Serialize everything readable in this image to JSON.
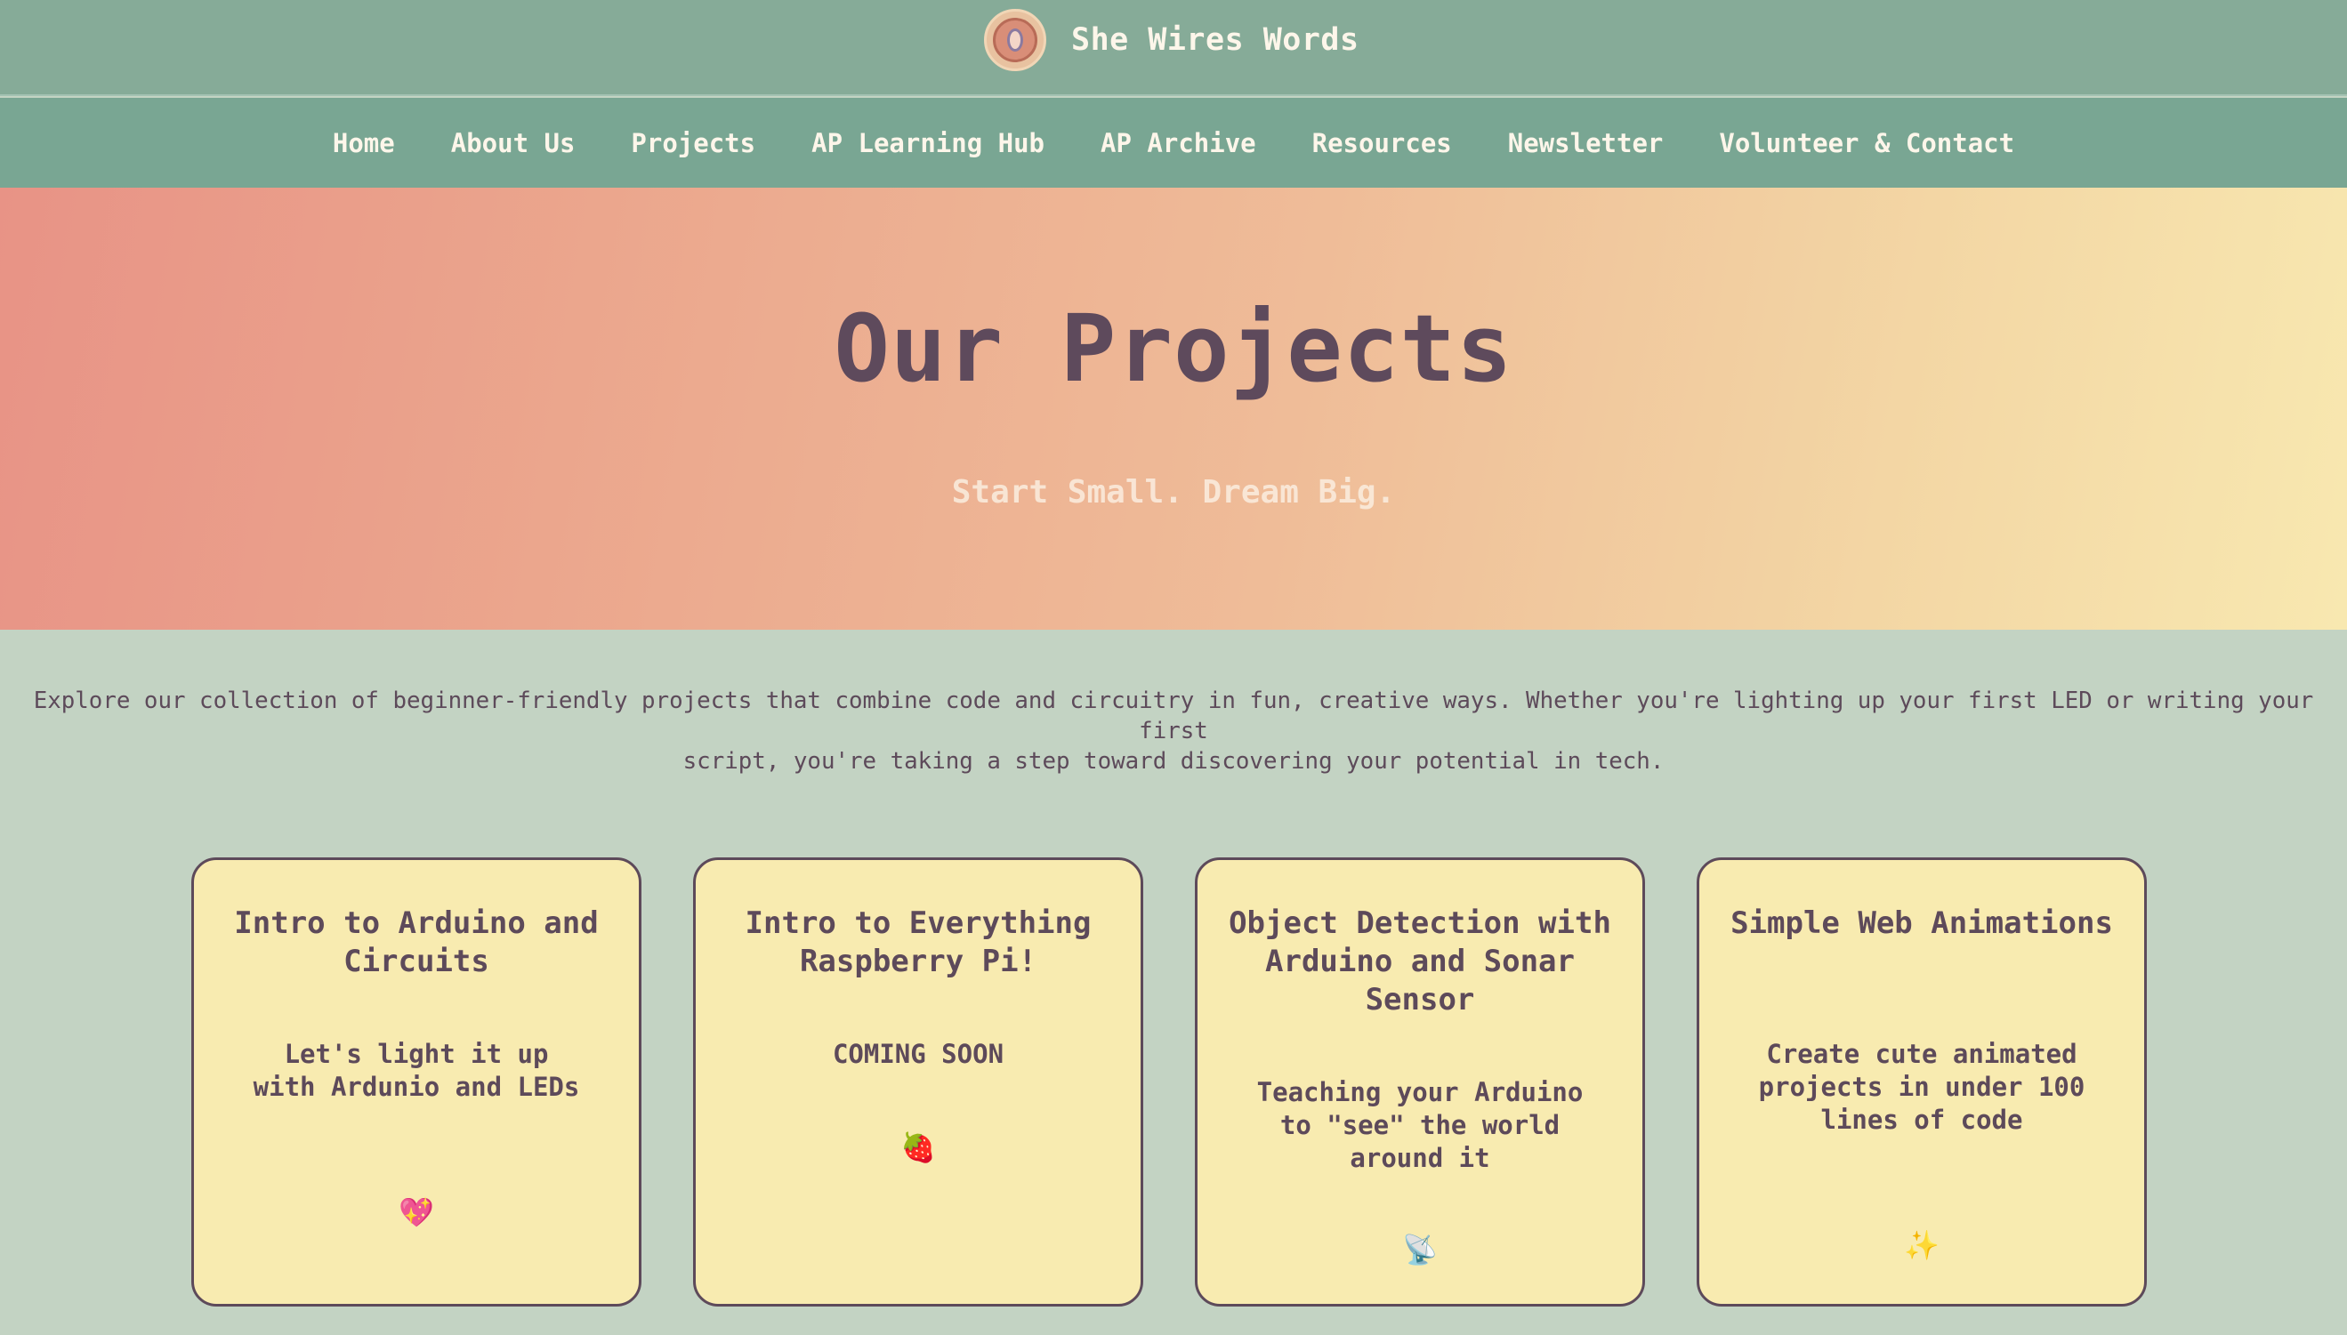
{
  "site": {
    "name": "She Wires Words",
    "logo_icon": "circuit-logo-icon"
  },
  "nav": {
    "items": [
      {
        "label": "Home"
      },
      {
        "label": "About Us"
      },
      {
        "label": "Projects"
      },
      {
        "label": "AP Learning Hub"
      },
      {
        "label": "AP Archive"
      },
      {
        "label": "Resources"
      },
      {
        "label": "Newsletter"
      },
      {
        "label": "Volunteer & Contact"
      }
    ]
  },
  "hero": {
    "title": "Our Projects",
    "subtitle": "Start Small. Dream Big."
  },
  "intro": {
    "line1": "Explore our collection of beginner-friendly projects that combine code and circuitry in fun, creative ways. Whether you're lighting up your first LED or writing your first",
    "line2": "script, you're taking a step toward discovering your potential in tech."
  },
  "cards": [
    {
      "title": "Intro to Arduino and Circuits",
      "description": "Let's light it up with Ardunio and LEDs",
      "emoji": "💖",
      "icon": "sparkling-heart-icon"
    },
    {
      "title": "Intro to Everything Raspberry Pi!",
      "description": "COMING SOON",
      "emoji": "🍓",
      "icon": "strawberry-icon"
    },
    {
      "title": "Object Detection with Arduino and Sonar Sensor",
      "description": "Teaching your Arduino to \"see\" the world around it",
      "emoji": "📡",
      "icon": "satellite-antenna-icon"
    },
    {
      "title": "Simple Web Animations",
      "description": "Create cute animated projects in under 100 lines of code",
      "emoji": "✨",
      "icon": "sparkles-icon"
    }
  ],
  "colors": {
    "brand_bar": "#86ab98",
    "nav_bar": "#79a693",
    "page_bg": "#c3d3c3",
    "card_bg": "#f8ebb0",
    "text": "#5d4a5a",
    "hero_gradient_start": "#e89386",
    "hero_gradient_end": "#f8e8b0"
  }
}
